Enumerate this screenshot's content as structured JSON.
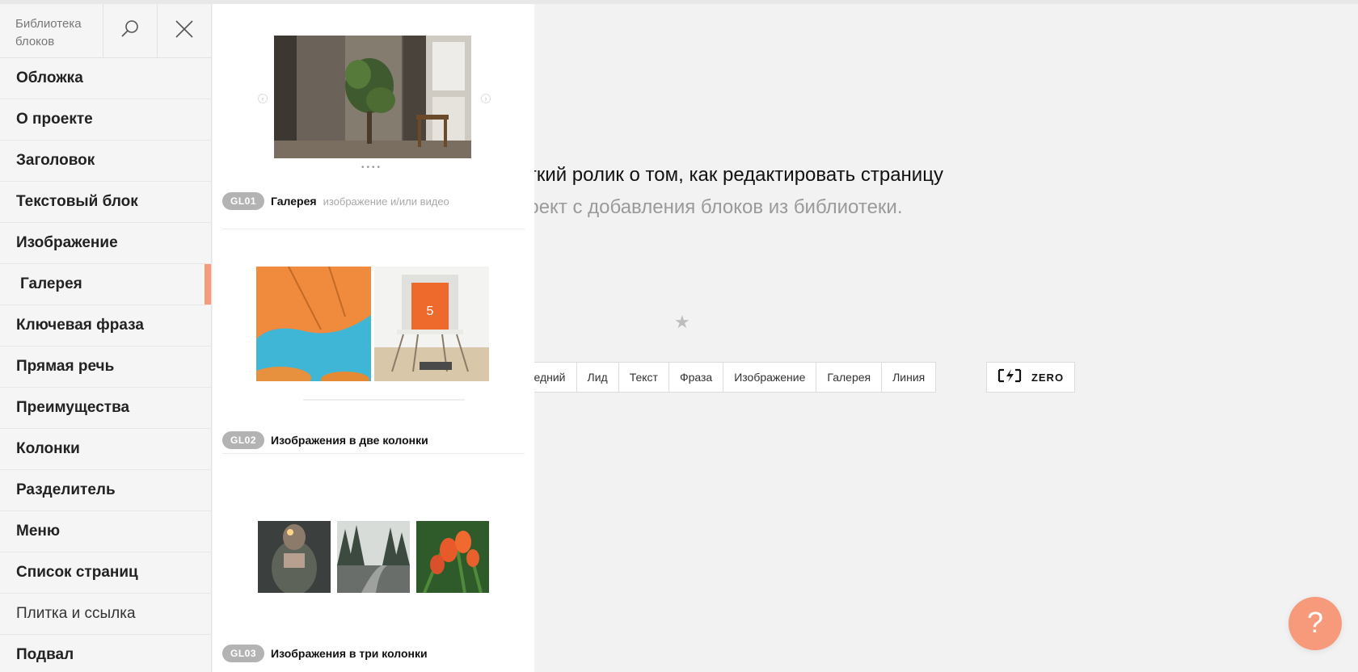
{
  "sidebar": {
    "title": "Библиотека блоков",
    "items": [
      {
        "label": "Обложка"
      },
      {
        "label": "О проекте"
      },
      {
        "label": "Заголовок"
      },
      {
        "label": "Текстовый блок"
      },
      {
        "label": "Изображение"
      },
      {
        "label": "Галерея"
      },
      {
        "label": "Ключевая фраза"
      },
      {
        "label": "Прямая речь"
      },
      {
        "label": "Преимущества"
      },
      {
        "label": "Колонки"
      },
      {
        "label": "Разделитель"
      },
      {
        "label": "Меню"
      },
      {
        "label": "Список страниц"
      },
      {
        "label": "Плитка и ссылка"
      },
      {
        "label": "Подвал"
      }
    ],
    "active_item": "Галерея"
  },
  "blocks": [
    {
      "code": "GL01",
      "name": "Галерея",
      "description": "изображение и/или видео"
    },
    {
      "code": "GL02",
      "name": "Изображения в две колонки",
      "description": ""
    },
    {
      "code": "GL03",
      "name": "Изображения в три колонки",
      "description": ""
    }
  ],
  "main": {
    "line1": "откий ролик о том, как редактировать страницу",
    "line2": "роект с добавления блоков из библиотеки."
  },
  "quickbar": {
    "buttons": [
      "ок: средний",
      "Лид",
      "Текст",
      "Фраза",
      "Изображение",
      "Галерея",
      "Линия"
    ],
    "zero_label": "ZERO"
  },
  "help": {
    "label": "?"
  },
  "colors": {
    "accent": "#f79a7c",
    "badge": "#b3b3b3"
  },
  "icons": [
    "search-icon",
    "close-icon",
    "zero-block-icon",
    "star-icon",
    "chevron-left-icon",
    "chevron-right-icon"
  ]
}
